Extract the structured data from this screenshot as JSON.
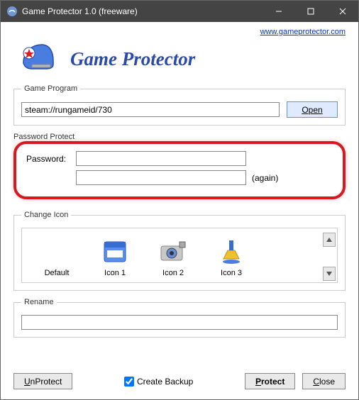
{
  "window": {
    "title": "Game Protector 1.0 (freeware)"
  },
  "toplink": {
    "text": "www.gameprotector.com"
  },
  "brand": {
    "title": "Game Protector"
  },
  "game_program": {
    "legend": "Game Program",
    "path": "steam://rungameid/730",
    "open": "Open"
  },
  "password_protect": {
    "legend": "Password Protect",
    "label": "Password:",
    "pwd1": "",
    "pwd2": "",
    "again": "(again)"
  },
  "change_icon": {
    "legend": "Change Icon",
    "items": [
      "Default",
      "Icon 1",
      "Icon 2",
      "Icon 3"
    ]
  },
  "rename": {
    "legend": "Rename",
    "value": ""
  },
  "footer": {
    "unprotect": "UnProtect",
    "backup": "Create Backup",
    "protect": "Protect",
    "close": "Close"
  }
}
